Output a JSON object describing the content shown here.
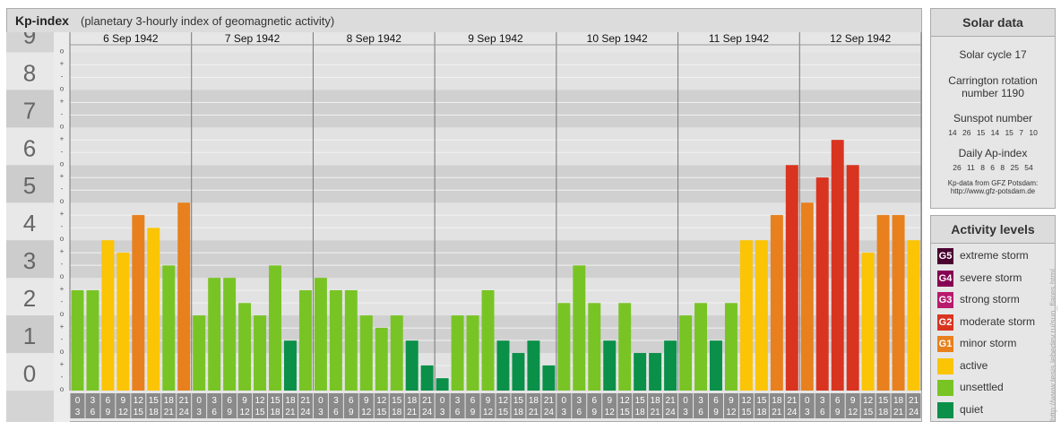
{
  "header": {
    "title": "Kp-index",
    "subtitle": "(planetary 3-hourly index of geomagnetic activity)"
  },
  "solar": {
    "title": "Solar data",
    "cycle": "Solar cycle 17",
    "carrington": "Carrington rotation",
    "carrington2": "number 1190",
    "sunspot_label": "Sunspot number",
    "sunspot_values": "14 26 15 14 15 7 10",
    "ap_label": "Daily Ap-index",
    "ap_values": "26 11 8 6 8 25 54",
    "source": "Kp-data from GFZ Potsdam:",
    "url": "http://www.gfz-potsdam.de"
  },
  "levels": {
    "title": "Activity levels",
    "items": [
      {
        "badge": "G5",
        "label": "extreme storm",
        "color": "#4a0030"
      },
      {
        "badge": "G4",
        "label": "severe storm",
        "color": "#860053"
      },
      {
        "badge": "G3",
        "label": "strong storm",
        "color": "#b81a6e"
      },
      {
        "badge": "G2",
        "label": "moderate storm",
        "color": "#d93420"
      },
      {
        "badge": "G1",
        "label": "minor storm",
        "color": "#e8801d"
      },
      {
        "badge": "",
        "label": "active",
        "color": "#fbc404"
      },
      {
        "badge": "",
        "label": "unsettled",
        "color": "#79c425"
      },
      {
        "badge": "",
        "label": "quiet",
        "color": "#0a9048"
      }
    ]
  },
  "watermark": "http://www.tesis.lebedev.ru/sun_flares.html",
  "chart_data": {
    "type": "bar",
    "y_ticks": [
      "0",
      "1",
      "2",
      "3",
      "4",
      "5",
      "6",
      "7",
      "8",
      "9"
    ],
    "sub_ticks": [
      "o",
      "-",
      "+"
    ],
    "days": [
      "6 Sep 1942",
      "7 Sep 1942",
      "8 Sep 1942",
      "9 Sep 1942",
      "10 Sep 1942",
      "11 Sep 1942",
      "12 Sep 1942"
    ],
    "hour_top": [
      "0",
      "3",
      "6",
      "9",
      "12",
      "15",
      "18",
      "21"
    ],
    "hour_bottom": [
      "3",
      "6",
      "9",
      "12",
      "15",
      "18",
      "21",
      "24"
    ],
    "ylim": [
      0,
      9
    ],
    "values": [
      [
        2.67,
        2.67,
        4.0,
        3.67,
        4.67,
        4.33,
        3.33,
        5.0
      ],
      [
        2.0,
        3.0,
        3.0,
        2.33,
        2.0,
        3.33,
        1.33,
        2.67
      ],
      [
        3.0,
        2.67,
        2.67,
        2.0,
        1.67,
        2.0,
        1.33,
        0.67
      ],
      [
        0.33,
        2.0,
        2.0,
        2.67,
        1.33,
        1.0,
        1.33,
        0.67
      ],
      [
        2.33,
        3.33,
        2.33,
        1.33,
        2.33,
        1.0,
        1.0,
        1.33
      ],
      [
        2.0,
        2.33,
        1.33,
        2.33,
        4.0,
        4.0,
        4.67,
        6.0
      ],
      [
        5.0,
        5.67,
        6.67,
        6.0,
        3.67,
        4.67,
        4.67,
        4.0
      ]
    ]
  }
}
